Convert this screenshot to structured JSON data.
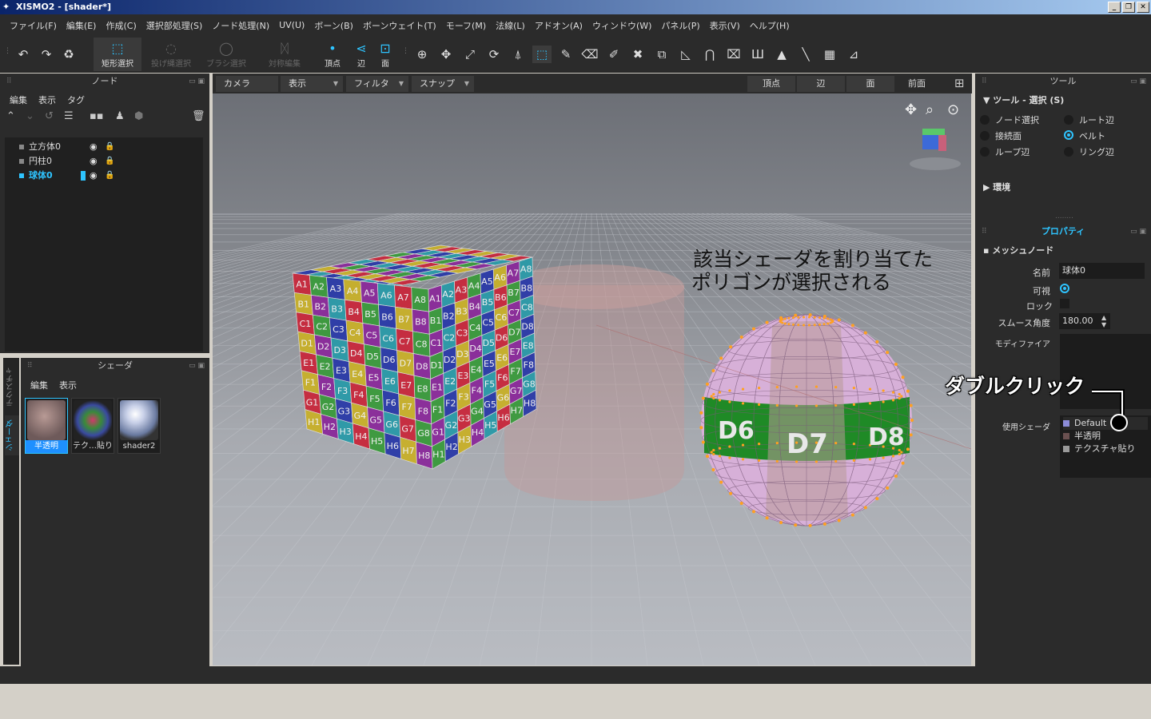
{
  "window": {
    "title": "XISMO2 - [shader*]"
  },
  "menu": [
    "ファイル(F)",
    "編集(E)",
    "作成(C)",
    "選択部処理(S)",
    "ノード処理(N)",
    "UV(U)",
    "ボーン(B)",
    "ボーンウェイト(T)",
    "モーフ(M)",
    "法線(L)",
    "アドオン(A)",
    "ウィンドウ(W)",
    "パネル(P)",
    "表示(V)",
    "ヘルプ(H)"
  ],
  "toolbar": {
    "rect_select": "矩形選択",
    "lasso_select": "投げ縄選択",
    "brush_select": "ブラシ選択",
    "symmetry": "対称編集",
    "vertex": "頂点",
    "edge": "辺",
    "face": "面"
  },
  "node_panel": {
    "title": "ノード",
    "menu": [
      "編集",
      "表示",
      "タグ"
    ],
    "nodes": [
      {
        "name": "立方体0",
        "selected": false
      },
      {
        "name": "円柱0",
        "selected": false
      },
      {
        "name": "球体0",
        "selected": true
      }
    ]
  },
  "shader_panel": {
    "title": "シェーダ",
    "menu": [
      "編集",
      "表示"
    ],
    "tabs": [
      "テクスチャ",
      "シェーダ"
    ],
    "thumbnails": [
      "半透明",
      "テク…貼り",
      "shader2"
    ]
  },
  "viewport_bar": {
    "camera": "カメラ",
    "display": "表示",
    "filter": "フィルタ",
    "snap": "スナップ",
    "vertex": "頂点",
    "edge": "辺",
    "face": "面",
    "view": "前面"
  },
  "tool_panel": {
    "title": "ツール",
    "section": "ツール - 選択 (S)",
    "options": [
      {
        "label": "ノード選択",
        "on": false
      },
      {
        "label": "ルート辺",
        "on": false
      },
      {
        "label": "接続面",
        "on": false
      },
      {
        "label": "ベルト",
        "on": true
      },
      {
        "label": "ループ辺",
        "on": false
      },
      {
        "label": "リング辺",
        "on": false
      }
    ],
    "env": "環境"
  },
  "properties": {
    "title": "プロパティ",
    "node_type": "メッシュノード",
    "name_label": "名前",
    "name_value": "球体0",
    "visible_label": "可視",
    "lock_label": "ロック",
    "smooth_label": "スムース角度",
    "smooth_value": "180.00",
    "modifier_label": "モディファイア",
    "shader_label": "使用シェーダ",
    "shaders": [
      {
        "name": "Default",
        "color": "#8c8cd8"
      },
      {
        "name": "半透明",
        "color": "#6a5050"
      },
      {
        "name": "テクスチャ貼り",
        "color": "#9a9a9a"
      }
    ]
  },
  "annotations": {
    "line1": "該当シェーダを割り当てた",
    "line2": "ポリゴンが選択される",
    "dblclick": "ダブルクリック"
  },
  "cube_labels": [
    "A1",
    "A2",
    "A3",
    "A4",
    "A5",
    "A6",
    "A7",
    "A8",
    "B1",
    "B2",
    "B3",
    "B4",
    "B5",
    "B6",
    "B7",
    "B8",
    "C1",
    "C2",
    "C3",
    "C4",
    "C5",
    "C6",
    "C7",
    "C8",
    "D1",
    "D2",
    "D3",
    "D4",
    "D5",
    "D6",
    "D7",
    "D8",
    "E1",
    "E2",
    "E3",
    "E4",
    "E5",
    "E6",
    "E7",
    "E8",
    "F1",
    "F2",
    "F3",
    "F4",
    "F5",
    "F6",
    "F7",
    "F8",
    "G1",
    "G2",
    "G3",
    "G4",
    "G5",
    "G6",
    "G7",
    "G8",
    "H1",
    "H2",
    "H3",
    "H4",
    "H5",
    "H6",
    "H7",
    "H8"
  ],
  "sphere_labels": [
    "D6",
    "D7",
    "D8"
  ],
  "accent": "#2ec4ff"
}
